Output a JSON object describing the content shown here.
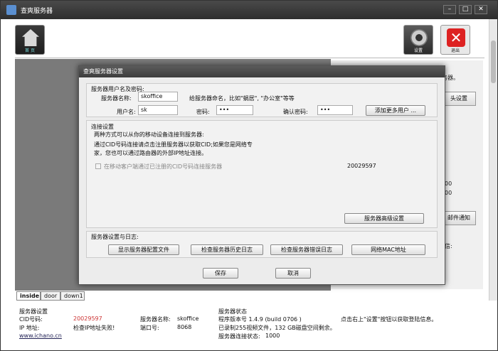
{
  "window": {
    "title": "查爽服务器",
    "minimize": "–",
    "maximize": "□",
    "close": "✕"
  },
  "toolbar": {
    "home_label": "首 页",
    "settings_label": "设置",
    "exit_label": "退出"
  },
  "right_pane": {
    "line1": "务器。",
    "camera_settings_button": "头设置",
    "value_a": "00",
    "value_b": "00",
    "email_notify_button": "邮件通知",
    "line_info": "信:"
  },
  "tabs": [
    "inside",
    "door",
    "down1"
  ],
  "status": {
    "server_settings_title": "服务器设置",
    "cid_label": "CID号码:",
    "cid_value": "20029597",
    "ip_label": "IP 地址:",
    "ip_value": "检查IP地址失败!",
    "website": "www.ichano.cn",
    "server_name_label": "服务器名称:",
    "server_name_value": "skoffice",
    "port_label": "端口号:",
    "port_value": "8068",
    "server_status_title": "服务器状态",
    "version": "程序版本号 1.4.9  (build 0706 )",
    "recorded": "已录制255视频文件，132 GB磁盘空间剩余。",
    "conn_label": "服务器连接状态:",
    "conn_value": "1000",
    "hint": "点击右上\"设置\"按钮以获取登陆信息。"
  },
  "dialog": {
    "title": "查爽服务器设置",
    "user_group_title": "服务器用户名及密码:",
    "server_name_label": "服务器名称:",
    "server_name_value": "skoffice",
    "server_name_hint": "给服务器命名，比如\"蜗居\", \"办公室\"等等",
    "username_label": "用户名:",
    "username_value": "sk",
    "password_label": "密码:",
    "password_value": "•••",
    "confirm_label": "确认密码:",
    "confirm_value": "•••",
    "add_users_button": "添加更多用户 ...",
    "conn_group_title": "连接设置",
    "conn_desc1": "两种方式可以从你的移动设备连接到服务器:",
    "conn_desc2": "通过CID号码连接请点击注册服务器以获取CID;如果您是网络专",
    "conn_desc3": "家，您也可以通过路由器的外部IP地址连接。",
    "cid_checkbox_label": "在移动客户端通过已注册的CID号码连接服务器",
    "cid_value": "20029597",
    "advanced_button": "服务器高级设置",
    "log_group_title": "服务器设置与日志:",
    "show_config_button": "显示服务器配置文件",
    "history_log_button": "检查服务器历史日志",
    "error_log_button": "检查服务器错误日志",
    "mac_button": "网络MAC地址",
    "save_button": "保存",
    "cancel_button": "取消"
  }
}
